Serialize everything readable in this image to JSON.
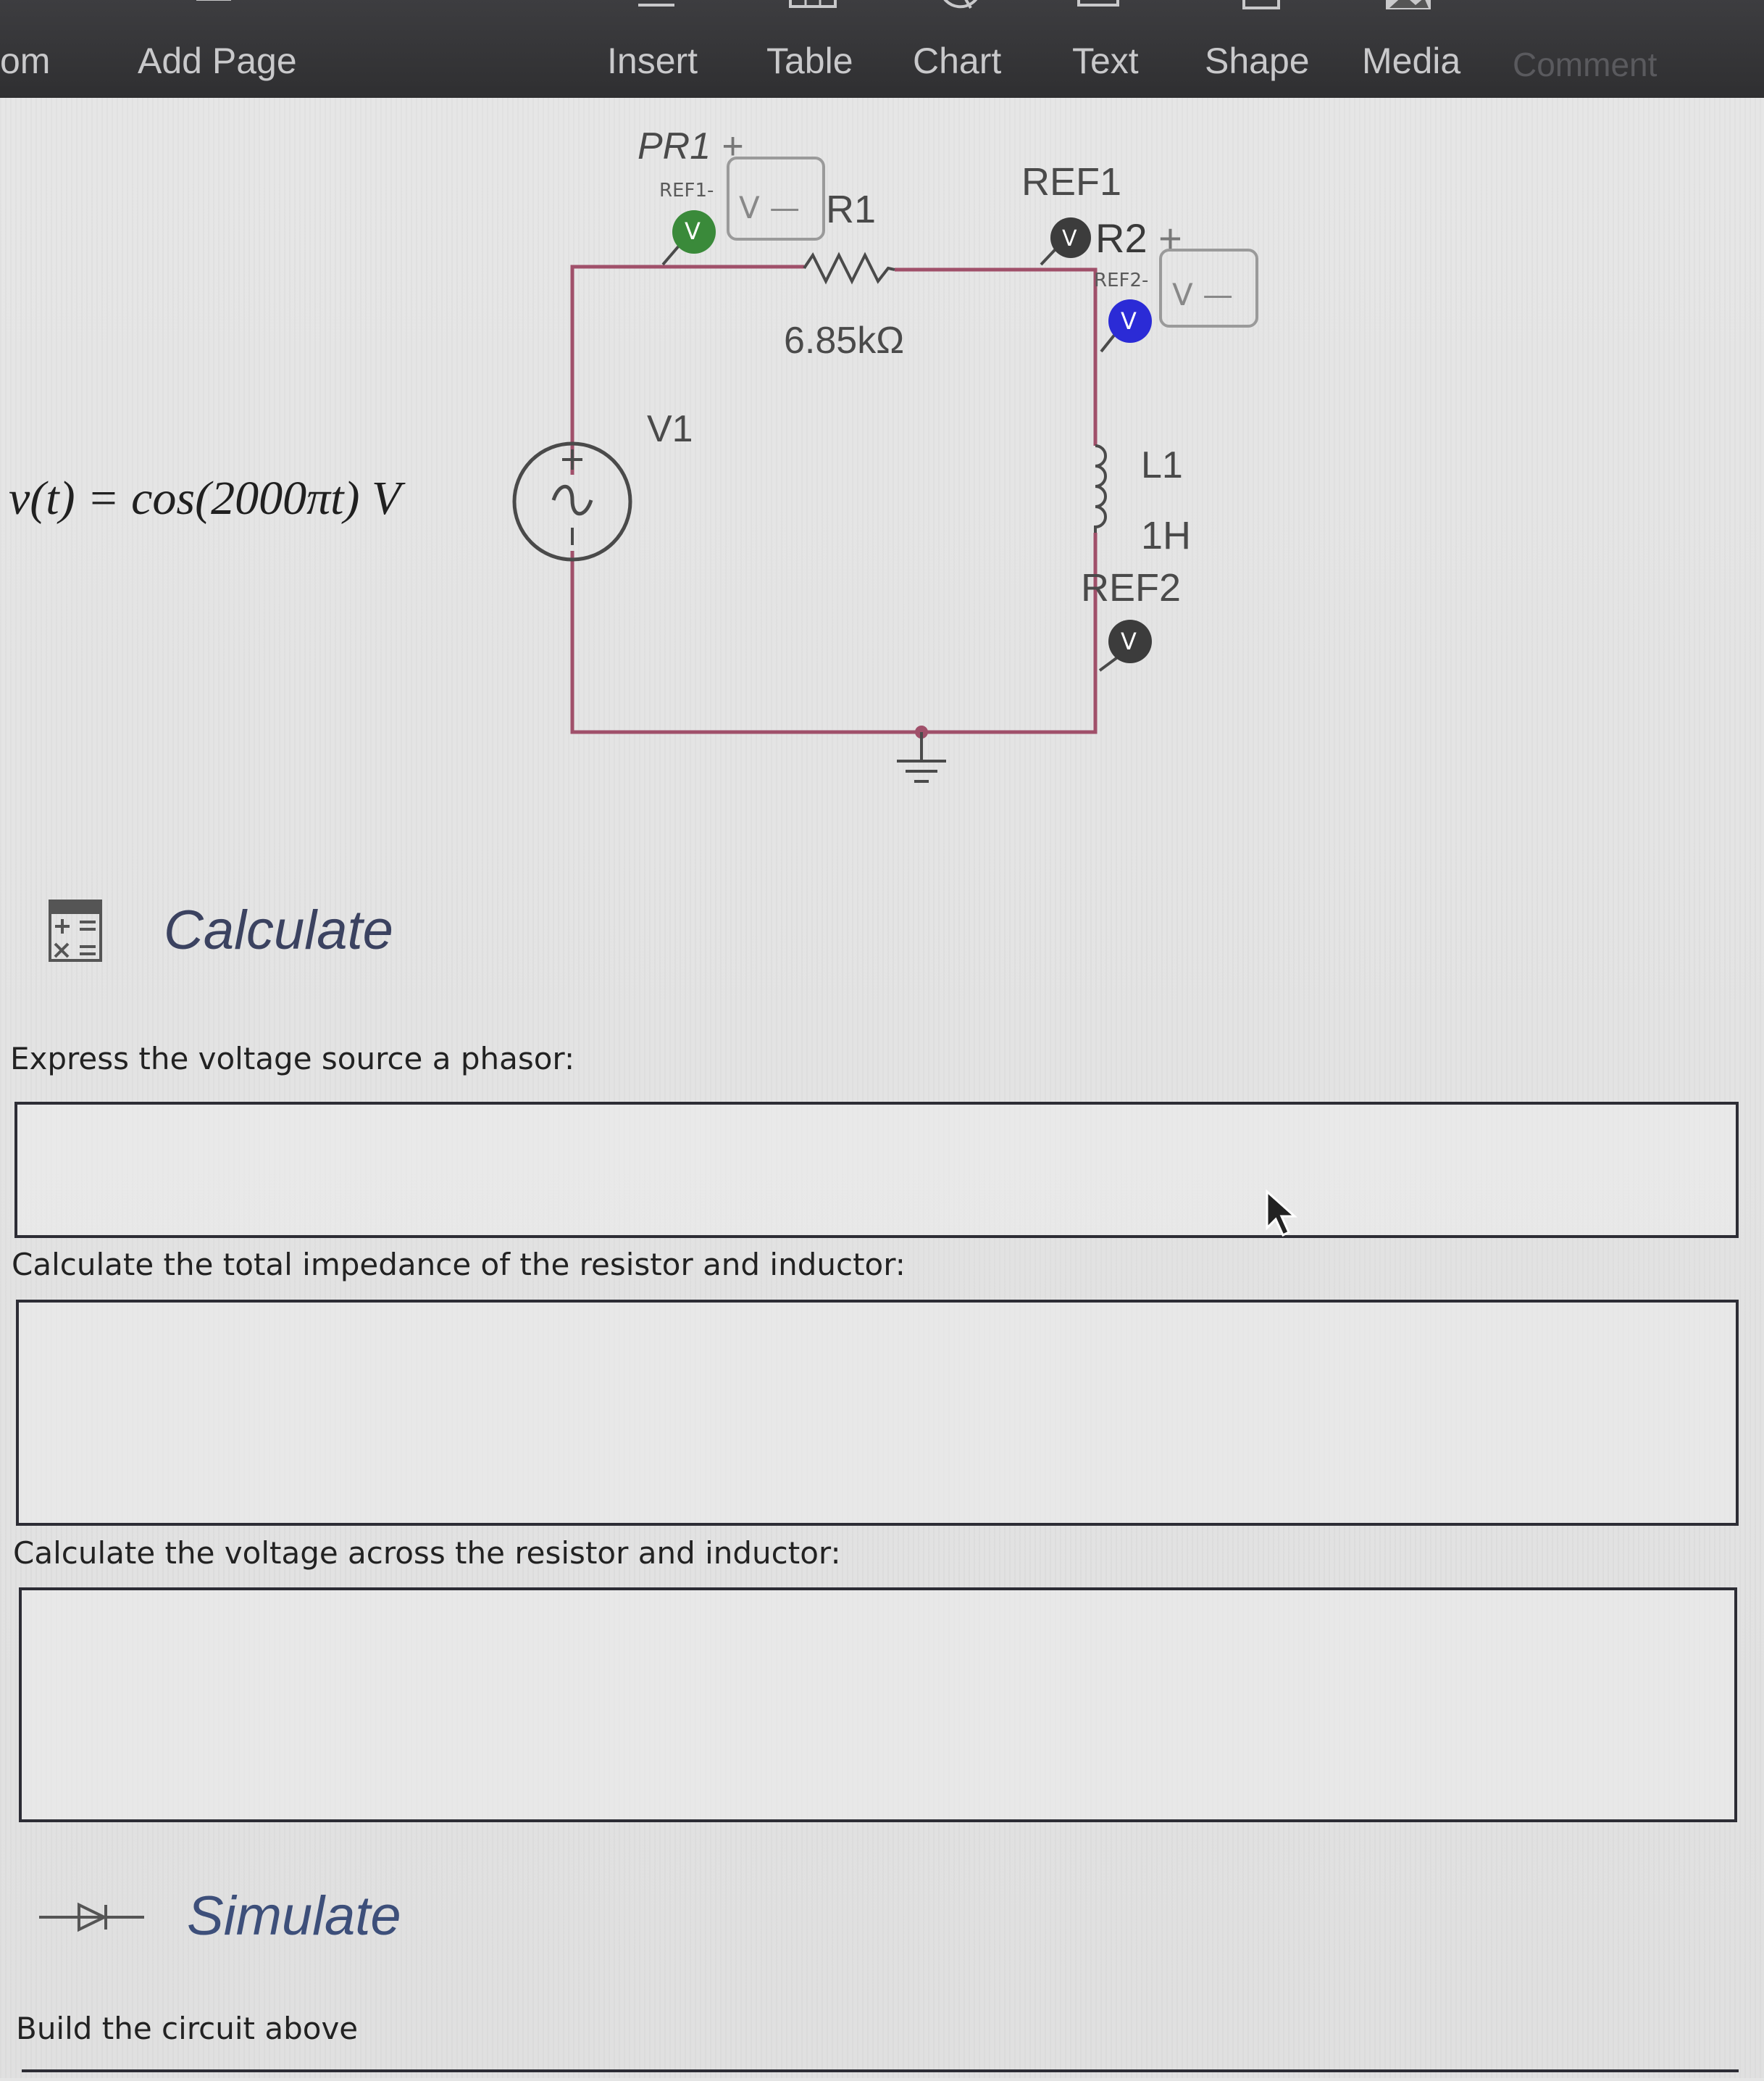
{
  "toolbar": {
    "items": [
      {
        "label": "om",
        "icon": ""
      },
      {
        "label": "Add Page",
        "icon": "add-page-icon"
      },
      {
        "label": "Insert",
        "icon": "insert-icon"
      },
      {
        "label": "Table",
        "icon": "table-icon"
      },
      {
        "label": "Chart",
        "icon": "chart-icon"
      },
      {
        "label": "Text",
        "icon": "text-icon"
      },
      {
        "label": "Shape",
        "icon": "shape-icon"
      },
      {
        "label": "Media",
        "icon": "media-icon"
      },
      {
        "label": "Comment",
        "icon": "comment-icon"
      }
    ]
  },
  "equation": "v(t) = cos(2000πt) V",
  "circuit": {
    "probe1": {
      "name": "PR1",
      "plus": "+",
      "ref": "REF1-",
      "readout": "V —",
      "badge": "V"
    },
    "resistor": {
      "name": "R1",
      "value": "6.85kΩ"
    },
    "source": {
      "name": "V1"
    },
    "probe2": {
      "ref_top": "REF1",
      "name": "R2",
      "plus": "+",
      "ref": "REF2-",
      "readout": "V —",
      "badge": "V"
    },
    "inductor": {
      "name": "L1",
      "value": "1H"
    },
    "ref2": {
      "label": "REF2",
      "badge": "V"
    }
  },
  "calculate": {
    "title": "Calculate",
    "q1": "Express the voltage source a phasor:",
    "q2": "Calculate the total impedance of the resistor and inductor:",
    "q3": "Calculate the voltage across the resistor and inductor:"
  },
  "simulate": {
    "title": "Simulate",
    "instruction": "Build the circuit above"
  },
  "colors": {
    "toolbar_bg": "#333335",
    "heading": "#3b4260",
    "wire": "#a0506a",
    "badge_green": "#3a8a3a",
    "badge_blue": "#2b2bd6",
    "badge_dark": "#3c3c3c"
  }
}
